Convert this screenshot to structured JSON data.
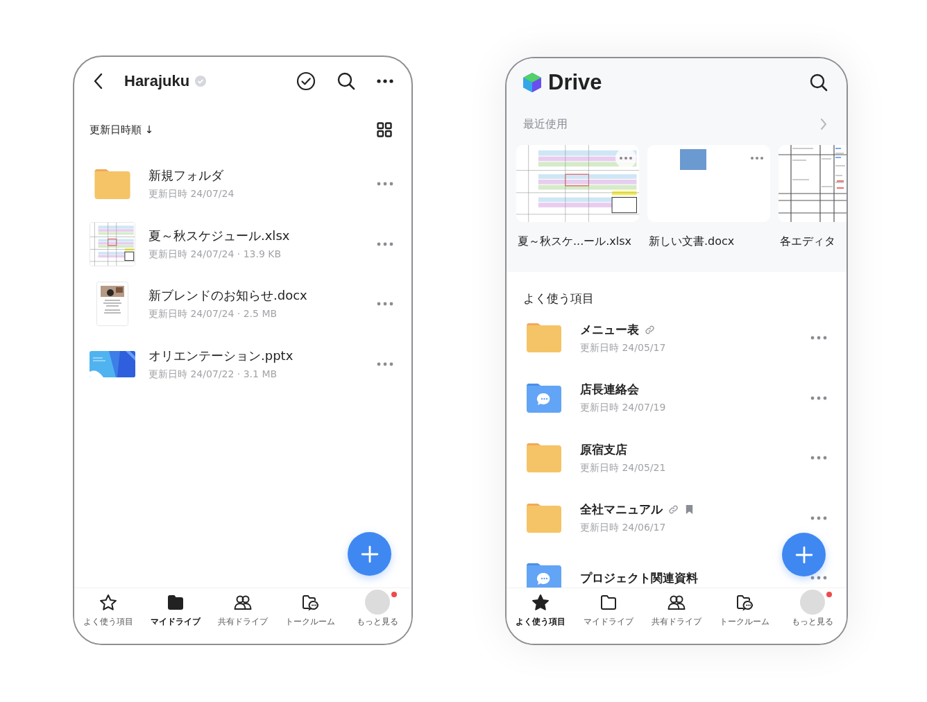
{
  "left_phone": {
    "header": {
      "title": "Harajuku"
    },
    "sort_label": "更新日時順 ↓",
    "files": [
      {
        "kind": "folder",
        "name": "新規フォルダ",
        "meta": "更新日時 24/07/24"
      },
      {
        "kind": "sheet",
        "name": "夏～秋スケジュール.xlsx",
        "meta": "更新日時 24/07/24 · 13.9 KB"
      },
      {
        "kind": "doc",
        "name": "新ブレンドのお知らせ.docx",
        "meta": "更新日時 24/07/24 · 2.5 MB"
      },
      {
        "kind": "slides",
        "name": "オリエンテーション.pptx",
        "meta": "更新日時 24/07/22 · 3.1 MB"
      }
    ],
    "tabs": [
      {
        "kind": "star",
        "label": "よく使う項目",
        "selected": false
      },
      {
        "kind": "folder",
        "label": "マイドライブ",
        "selected": true
      },
      {
        "kind": "people",
        "label": "共有ドライブ",
        "selected": false
      },
      {
        "kind": "chat-folder",
        "label": "トークルーム",
        "selected": false
      },
      {
        "kind": "avatar",
        "label": "もっと見る",
        "selected": false,
        "notification": true
      }
    ]
  },
  "right_phone": {
    "title": "Drive",
    "recent": {
      "heading": "最近使用",
      "items": [
        {
          "kind": "sheet",
          "name": "夏～秋スケ...ール.xlsx"
        },
        {
          "kind": "doc",
          "name": "新しい文書.docx"
        },
        {
          "kind": "sheet-lines",
          "name": "各エディタ"
        }
      ]
    },
    "favorites": {
      "heading": "よく使う項目",
      "items": [
        {
          "kind": "folder",
          "name": "メニュー表",
          "meta": "更新日時 24/05/17",
          "link": true,
          "bookmark": false
        },
        {
          "kind": "chat-folder",
          "name": "店長連絡会",
          "meta": "更新日時 24/07/19",
          "link": false,
          "bookmark": false
        },
        {
          "kind": "folder",
          "name": "原宿支店",
          "meta": "更新日時 24/05/21",
          "link": false,
          "bookmark": false
        },
        {
          "kind": "folder",
          "name": "全社マニュアル",
          "meta": "更新日時 24/06/17",
          "link": true,
          "bookmark": true
        },
        {
          "kind": "chat-folder",
          "name": "プロジェクト関連資料",
          "link": false,
          "bookmark": false
        }
      ]
    },
    "tabs": [
      {
        "kind": "star",
        "label": "よく使う項目",
        "selected": true
      },
      {
        "kind": "folder",
        "label": "マイドライブ",
        "selected": false
      },
      {
        "kind": "people",
        "label": "共有ドライブ",
        "selected": false
      },
      {
        "kind": "chat-folder",
        "label": "トークルーム",
        "selected": false
      },
      {
        "kind": "avatar",
        "label": "もっと見る",
        "selected": false,
        "notification": true
      }
    ]
  }
}
